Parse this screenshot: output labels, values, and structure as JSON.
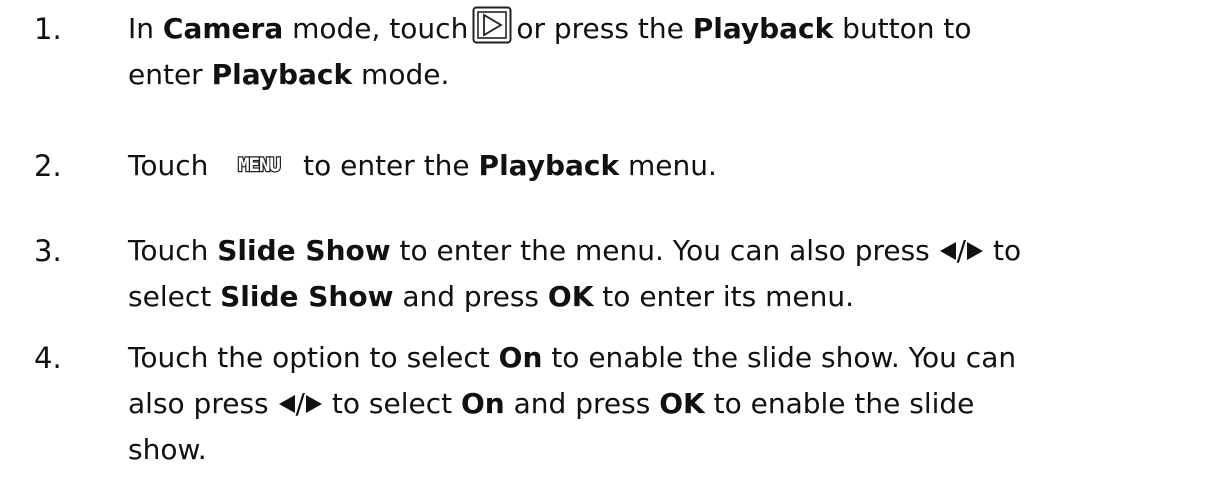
{
  "steps": [
    {
      "number": "1.",
      "lines": [
        [
          "In ",
          "Camera",
          " mode, touch",
          "",
          "or press the ",
          "Playback",
          " button to"
        ],
        [
          "enter ",
          "Playback",
          " mode."
        ]
      ]
    },
    {
      "number": "2.",
      "lines": [
        [
          "Touch",
          "",
          "to enter the ",
          "Playback",
          " menu."
        ]
      ],
      "icon_text": "MENU"
    },
    {
      "number": "3.",
      "lines": [
        [
          "Touch ",
          "Slide Show",
          " to enter the menu. You can also press ",
          "/",
          " to"
        ],
        [
          "select ",
          "Slide Show",
          " and press ",
          "OK",
          " to enter its menu."
        ]
      ]
    },
    {
      "number": "4.",
      "lines": [
        [
          "Touch the option to select ",
          "On",
          " to enable the slide show. You can"
        ],
        [
          "also press ",
          "/",
          " to select ",
          "On",
          " and press ",
          "OK",
          " to enable the slide"
        ],
        [
          "show."
        ]
      ]
    }
  ],
  "icons": {
    "playback": "playback-button-icon",
    "menu": "menu-button-icon",
    "left": "left-triangle-icon",
    "right": "right-triangle-icon"
  }
}
